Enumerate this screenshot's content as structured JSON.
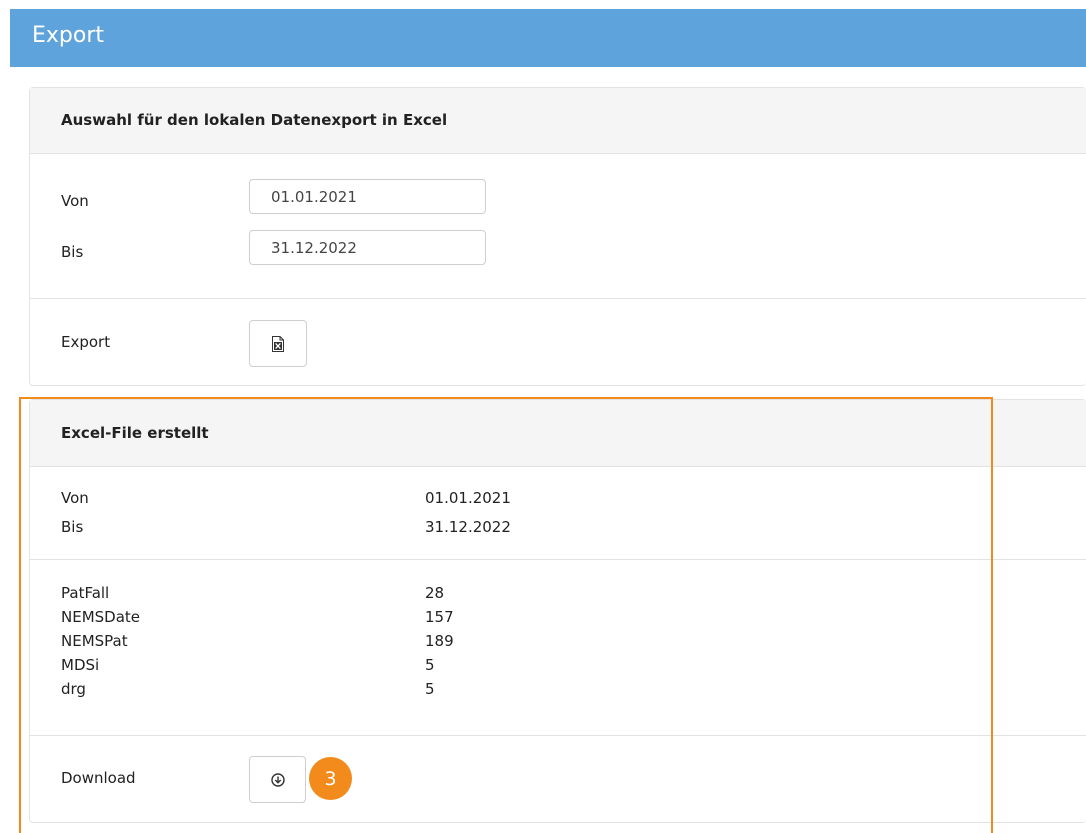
{
  "header": {
    "title": "Export"
  },
  "selection_panel": {
    "title": "Auswahl für den lokalen Datenexport in Excel",
    "from_label": "Von",
    "from_value": "01.01.2021",
    "to_label": "Bis",
    "to_value": "31.12.2022",
    "export_label": "Export",
    "export_icon": "excel-file-icon"
  },
  "result_panel": {
    "title": "Excel-File erstellt",
    "period": [
      {
        "label": "Von",
        "value": "01.01.2021"
      },
      {
        "label": "Bis",
        "value": "31.12.2022"
      }
    ],
    "counts": [
      {
        "label": "PatFall",
        "value": "28"
      },
      {
        "label": "NEMSDate",
        "value": "157"
      },
      {
        "label": "NEMSPat",
        "value": "189"
      },
      {
        "label": "MDSi",
        "value": "5"
      },
      {
        "label": "drg",
        "value": "5"
      }
    ],
    "download_label": "Download",
    "download_icon": "download-circle-icon"
  },
  "annotation": {
    "step_number": "3",
    "color": "#f28b1c"
  },
  "colors": {
    "header_bg": "#5fa3dc",
    "panel_header_bg": "#f5f5f5",
    "highlight": "#f28b1c"
  }
}
